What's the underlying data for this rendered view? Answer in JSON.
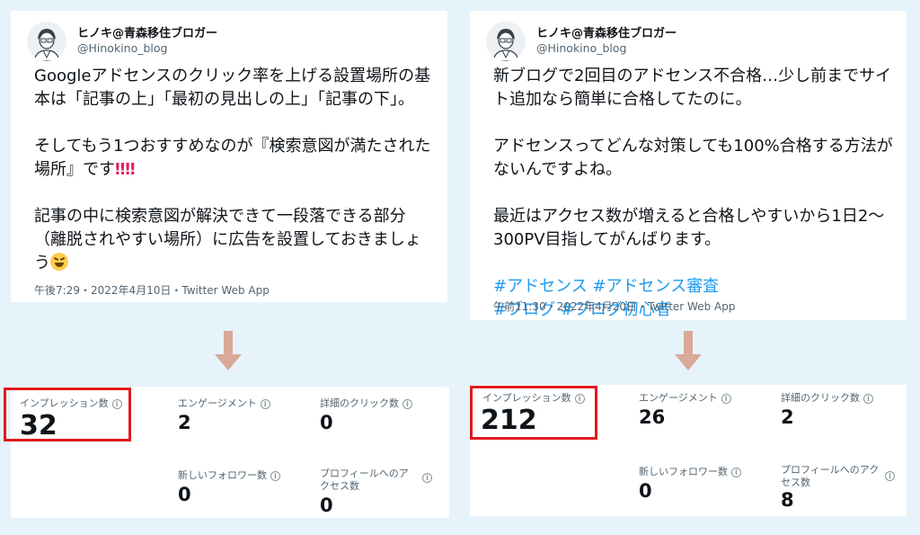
{
  "left": {
    "tweet": {
      "author_name": "ヒノキ@青森移住ブロガー",
      "author_handle": "@Hinokino_blog",
      "lines": [
        "Googleアドセンスのクリック率を上げる設置場所の基本は「記事の上」「最初の見出しの上」「記事の下」。",
        "そしてもう1つおすすめなのが『検索意図が満たされた場所』です",
        "記事の中に検索意図が解決できて一段落できる部分（離脱されやすい場所）に広告を設置しておきましょう"
      ],
      "emphasis": "‼‼",
      "timestamp": "午後7:29・2022年4月10日・Twitter Web App"
    },
    "stats": {
      "impressions_label": "インプレッション数",
      "impressions_value": "32",
      "engagements_label": "エンゲージメント",
      "engagements_value": "2",
      "detail_clicks_label": "詳細のクリック数",
      "detail_clicks_value": "0",
      "new_followers_label": "新しいフォロワー数",
      "new_followers_value": "0",
      "profile_visits_label": "プロフィールへのアクセス数",
      "profile_visits_value": "0"
    }
  },
  "right": {
    "tweet": {
      "author_name": "ヒノキ@青森移住ブロガー",
      "author_handle": "@Hinokino_blog",
      "lines": [
        "新ブログで2回目のアドセンス不合格…少し前までサイト追加なら簡単に合格してたのに。",
        "アドセンスってどんな対策しても100%合格する方法がないんですよね。",
        "最近はアクセス数が増えると合格しやすいから1日2〜300PV目指してがんばります。"
      ],
      "hashtags_line1": "#アドセンス #アドセンス審査",
      "hashtags_line2": "#ブログ #ブログ初心者",
      "timestamp": "午前11:30・2022年4月20日・Twitter Web App"
    },
    "stats": {
      "impressions_label": "インプレッション数",
      "impressions_value": "212",
      "engagements_label": "エンゲージメント",
      "engagements_value": "26",
      "detail_clicks_label": "詳細のクリック数",
      "detail_clicks_value": "2",
      "new_followers_label": "新しいフォロワー数",
      "new_followers_value": "0",
      "profile_visits_label": "プロフィールへのアクセス数",
      "profile_visits_value": "8"
    }
  },
  "colors": {
    "background": "#e6f3fb",
    "arrow": "#d9a99a",
    "highlight": "#e0191f",
    "hashtag": "#1d9bf0"
  }
}
